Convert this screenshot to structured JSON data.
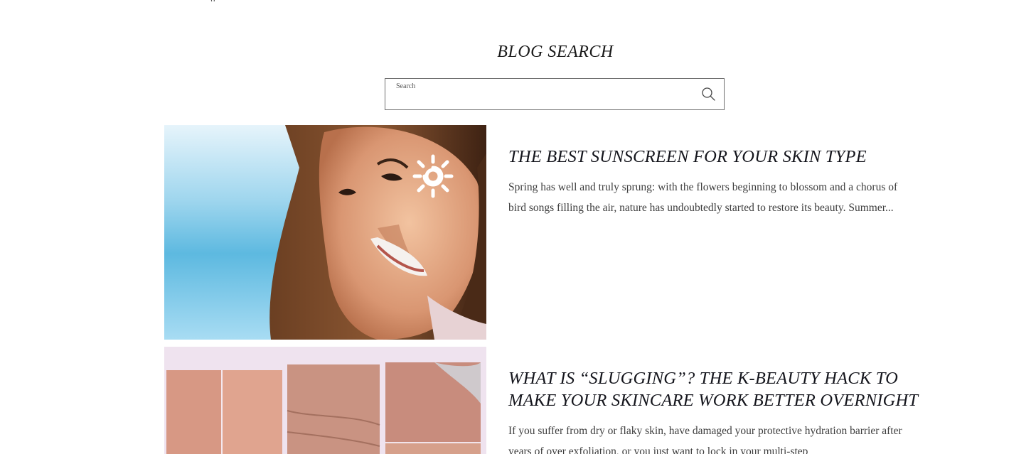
{
  "header_cut_text": "g",
  "blog_search": {
    "title": "BLOG SEARCH",
    "label": "Search",
    "value": ""
  },
  "articles": [
    {
      "title": "THE BEST SUNSCREEN FOR YOUR SKIN TYPE",
      "excerpt": "Spring has well and truly sprung: with the flowers beginning to blossom and a chorus of bird songs filling the air, nature has undoubtedly started to restore its beauty. Summer...",
      "image": "woman-smiling-with-sunscreen-sun-on-cheek"
    },
    {
      "title": "WHAT IS “SLUGGING”? THE K-BEAUTY HACK TO MAKE YOUR SKINCARE WORK BETTER OVERNIGHT",
      "excerpt": "If you suffer from dry or flaky skin, have damaged your protective hydration barrier after years of over exfoliation, or you just want to lock in your multi-step",
      "image": "skin-closeup-collage"
    }
  ],
  "colors": {
    "text": "#222222",
    "border": "#6f6f6f",
    "collage_bg": "#efe3ef"
  },
  "icons": {
    "search": "magnifier-icon"
  }
}
